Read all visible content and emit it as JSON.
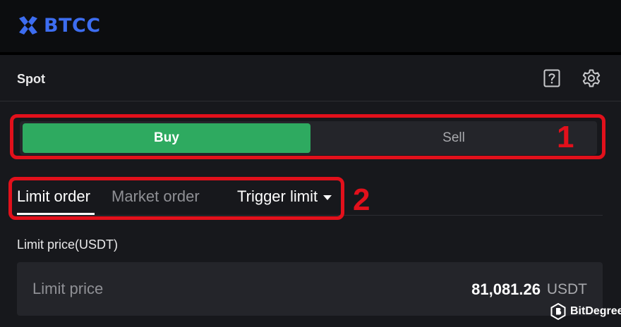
{
  "brand": {
    "name": "BTCC",
    "color": "#3d6df0"
  },
  "panel": {
    "title": "Spot",
    "help_icon": "help-question-icon",
    "settings_icon": "gear-icon"
  },
  "side_toggle": {
    "buy_label": "Buy",
    "sell_label": "Sell",
    "active": "Buy",
    "buy_color": "#2eaa60"
  },
  "order_tabs": {
    "limit": "Limit order",
    "market": "Market order",
    "trigger": "Trigger limit",
    "active": "Limit order"
  },
  "annotations": {
    "label_1": "1",
    "label_2": "2",
    "color": "#e2101b"
  },
  "price_field": {
    "label": "Limit price(USDT)",
    "placeholder": "Limit price",
    "value": "81,081.26",
    "unit": "USDT"
  },
  "watermark": {
    "text": "BitDegree"
  }
}
